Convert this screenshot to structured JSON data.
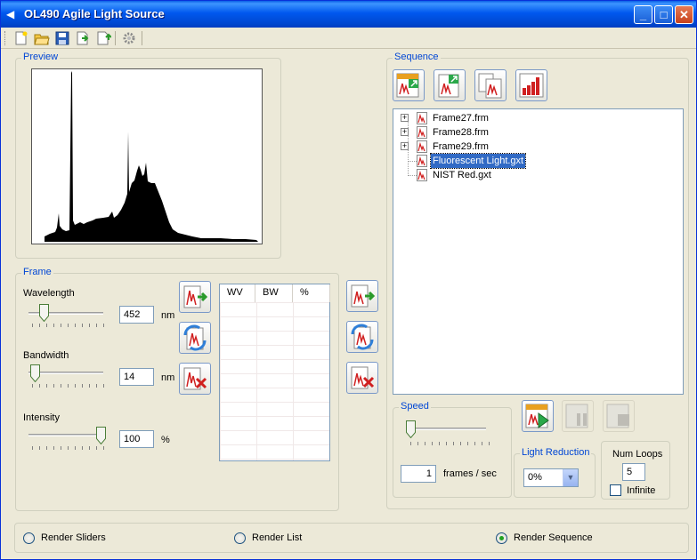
{
  "window": {
    "title": "OL490 Agile Light Source"
  },
  "preview": {
    "label": "Preview"
  },
  "frame": {
    "label": "Frame",
    "wavelength": {
      "label": "Wavelength",
      "value": "452",
      "unit": "nm",
      "slider_fraction": 0.18
    },
    "bandwidth": {
      "label": "Bandwidth",
      "value": "14",
      "unit": "nm",
      "slider_fraction": 0.05
    },
    "intensity": {
      "label": "Intensity",
      "value": "100",
      "unit": "%",
      "slider_fraction": 1.0
    },
    "table": {
      "columns": [
        "WV",
        "BW",
        "%"
      ],
      "rows": []
    }
  },
  "sequence": {
    "label": "Sequence",
    "items": [
      {
        "label": "Frame27.frm",
        "expandable": true,
        "selected": false
      },
      {
        "label": "Frame28.frm",
        "expandable": true,
        "selected": false
      },
      {
        "label": "Frame29.frm",
        "expandable": true,
        "selected": false
      },
      {
        "label": "Fluorescent Light.gxt",
        "expandable": false,
        "selected": true
      },
      {
        "label": "NIST Red.gxt",
        "expandable": false,
        "selected": false
      }
    ]
  },
  "speed": {
    "label": "Speed",
    "value": "1",
    "unit": "frames / sec",
    "slider_fraction": 0.0
  },
  "light_reduction": {
    "label": "Light Reduction",
    "value": "0%"
  },
  "num_loops": {
    "label": "Num Loops",
    "value": "5",
    "infinite_label": "Infinite",
    "infinite_checked": false
  },
  "render_mode": {
    "options": [
      "Render Sliders",
      "Render List",
      "Render Sequence"
    ],
    "selected": "Render Sequence"
  },
  "colors": {
    "title_bar": "#0058ee",
    "group_label": "#0046d5",
    "selection": "#316ac5",
    "spectrum": "#000000"
  }
}
